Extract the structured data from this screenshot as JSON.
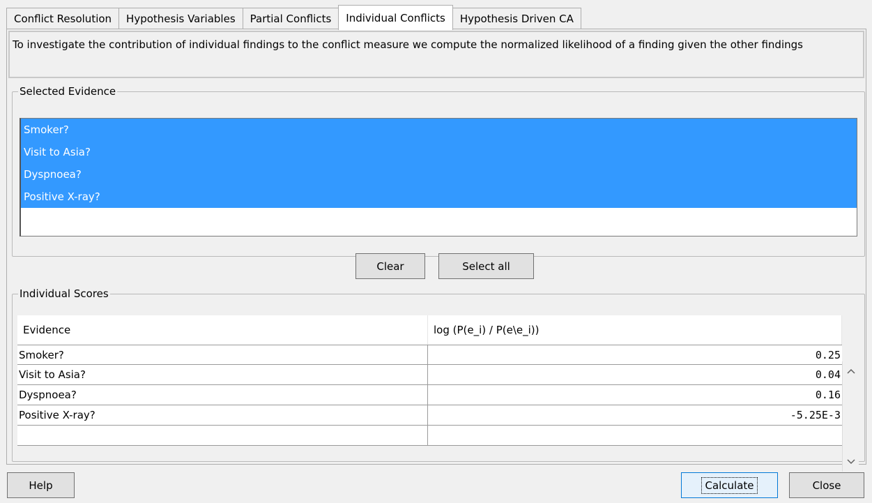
{
  "tabs": [
    {
      "label": "Conflict Resolution",
      "active": false
    },
    {
      "label": "Hypothesis Variables",
      "active": false
    },
    {
      "label": "Partial Conflicts",
      "active": false
    },
    {
      "label": "Individual Conflicts",
      "active": true
    },
    {
      "label": "Hypothesis Driven CA",
      "active": false
    }
  ],
  "description": "To investigate the contribution of individual findings to the conflict measure we compute the normalized likelihood of a finding given the other findings",
  "selected_evidence": {
    "legend": "Selected Evidence",
    "items": [
      "Smoker?",
      "Visit to Asia?",
      "Dyspnoea?",
      "Positive X-ray?"
    ],
    "clear_label": "Clear",
    "select_all_label": "Select all"
  },
  "individual_scores": {
    "legend": "Individual Scores",
    "columns": [
      "Evidence",
      "log (P(e_i) / P(e\\e_i))"
    ],
    "rows": [
      {
        "evidence": "Smoker?",
        "score": "0.25"
      },
      {
        "evidence": "Visit to Asia?",
        "score": "0.04"
      },
      {
        "evidence": "Dyspnoea?",
        "score": "0.16"
      },
      {
        "evidence": "Positive X-ray?",
        "score": "-5.25E-3"
      },
      {
        "evidence": "",
        "score": ""
      }
    ]
  },
  "footer": {
    "help_label": "Help",
    "calculate_label": "Calculate",
    "close_label": "Close"
  },
  "colors": {
    "selection": "#3399ff",
    "focus_border": "#0078d7"
  },
  "icons": {
    "scroll_up": "chevron-up-icon",
    "scroll_down": "chevron-down-icon"
  }
}
